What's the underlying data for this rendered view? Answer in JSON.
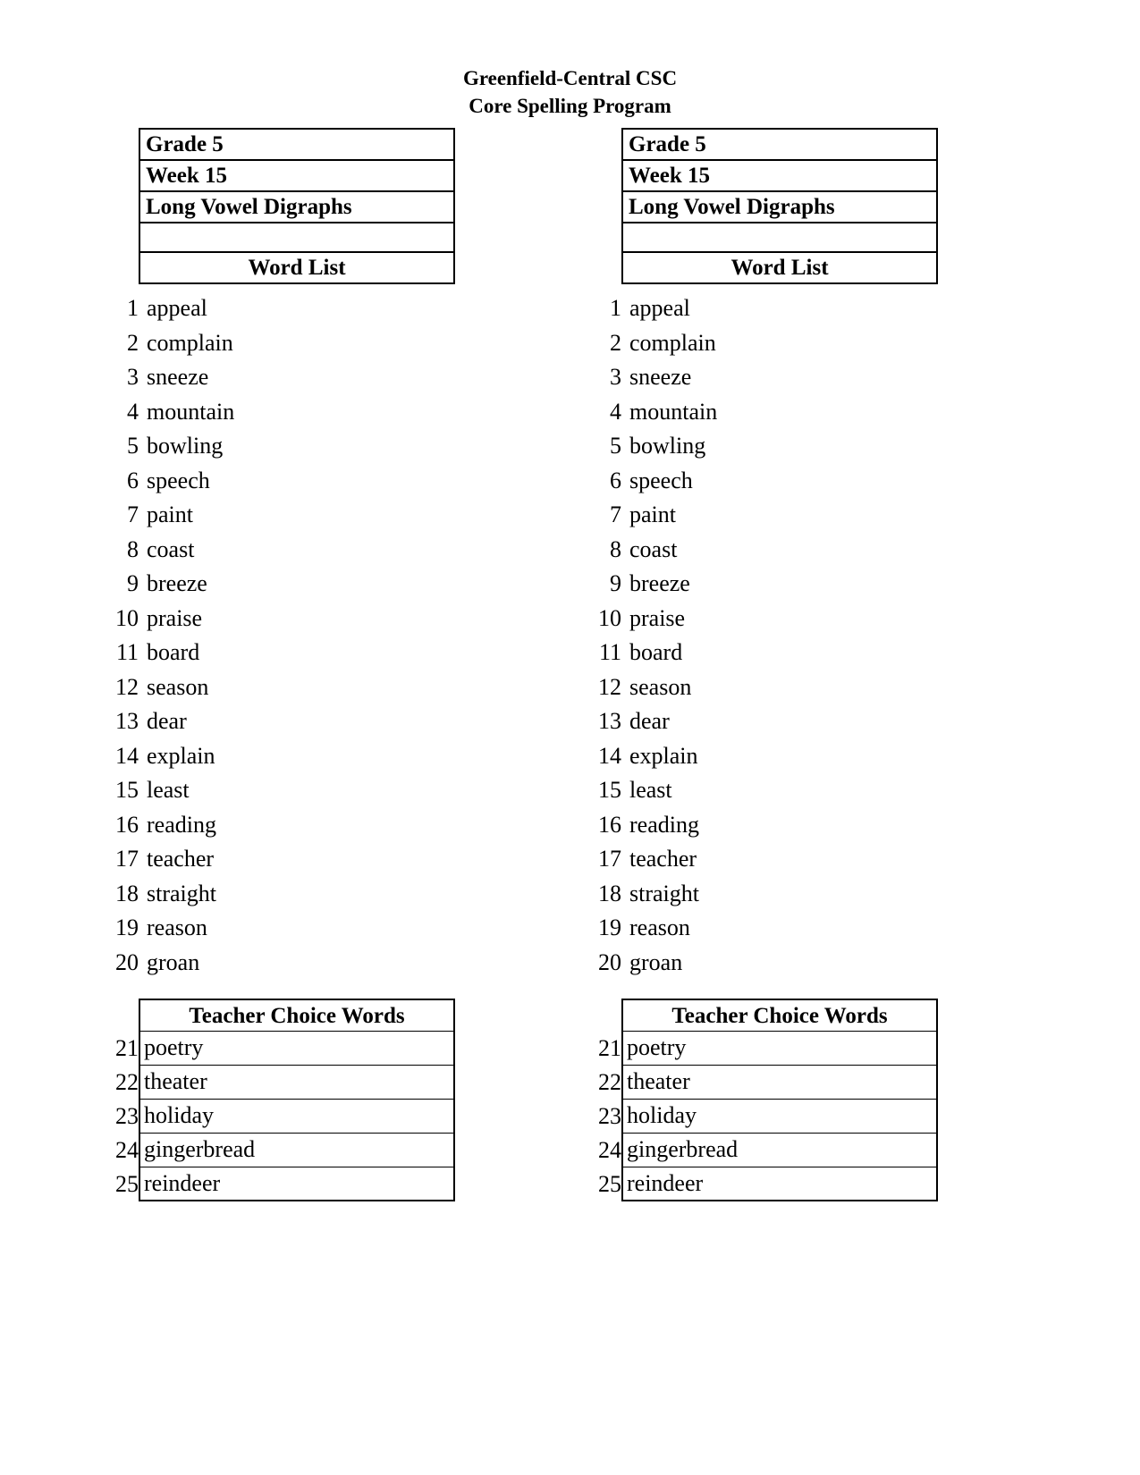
{
  "document": {
    "title_line_1": "Greenfield-Central CSC",
    "title_line_2": "Core Spelling Program"
  },
  "header_rows": {
    "grade": "Grade 5",
    "week": "Week 15",
    "unit": "Long Vowel Digraphs",
    "blank": "",
    "word_list_label": "Word List"
  },
  "teacher_choice_header": "Teacher Choice Words",
  "word_list": [
    {
      "num": "1",
      "word": "appeal"
    },
    {
      "num": "2",
      "word": "complain"
    },
    {
      "num": "3",
      "word": "sneeze"
    },
    {
      "num": "4",
      "word": "mountain"
    },
    {
      "num": "5",
      "word": "bowling"
    },
    {
      "num": "6",
      "word": "speech"
    },
    {
      "num": "7",
      "word": "paint"
    },
    {
      "num": "8",
      "word": "coast"
    },
    {
      "num": "9",
      "word": "breeze"
    },
    {
      "num": "10",
      "word": "praise"
    },
    {
      "num": "11",
      "word": "board"
    },
    {
      "num": "12",
      "word": "season"
    },
    {
      "num": "13",
      "word": "dear"
    },
    {
      "num": "14",
      "word": "explain"
    },
    {
      "num": "15",
      "word": "least"
    },
    {
      "num": "16",
      "word": "reading"
    },
    {
      "num": "17",
      "word": "teacher"
    },
    {
      "num": "18",
      "word": "straight"
    },
    {
      "num": "19",
      "word": "reason"
    },
    {
      "num": "20",
      "word": "groan"
    }
  ],
  "teacher_choice_words": [
    {
      "num": "21",
      "word": "poetry"
    },
    {
      "num": "22",
      "word": "theater"
    },
    {
      "num": "23",
      "word": "holiday"
    },
    {
      "num": "24",
      "word": "gingerbread"
    },
    {
      "num": "25",
      "word": "reindeer"
    }
  ]
}
